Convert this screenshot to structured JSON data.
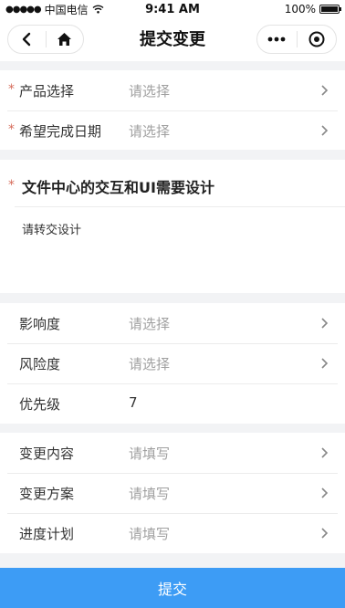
{
  "status_bar": {
    "carrier": "中国电信",
    "time": "9:41 AM",
    "battery": "100%",
    "battery_level": 1.0
  },
  "nav": {
    "title": "提交变更"
  },
  "basic": {
    "product_label": "产品选择",
    "product_value": "请选择",
    "date_label": "希望完成日期",
    "date_value": "请选择"
  },
  "requirement": {
    "title": "文件中心的交互和UI需要设计",
    "content": "请转交设计"
  },
  "assessment": {
    "impact_label": "影响度",
    "impact_value": "请选择",
    "risk_label": "风险度",
    "risk_value": "请选择",
    "priority_label": "优先级",
    "priority_value": "7"
  },
  "plan": {
    "content_label": "变更内容",
    "content_value": "请填写",
    "scheme_label": "变更方案",
    "scheme_value": "请填写",
    "schedule_label": "进度计划",
    "schedule_value": "请填写"
  },
  "submit_label": "提交",
  "colors": {
    "accent": "#3d9cf5",
    "required": "#d66b5a",
    "placeholder": "#a0a0a0"
  }
}
